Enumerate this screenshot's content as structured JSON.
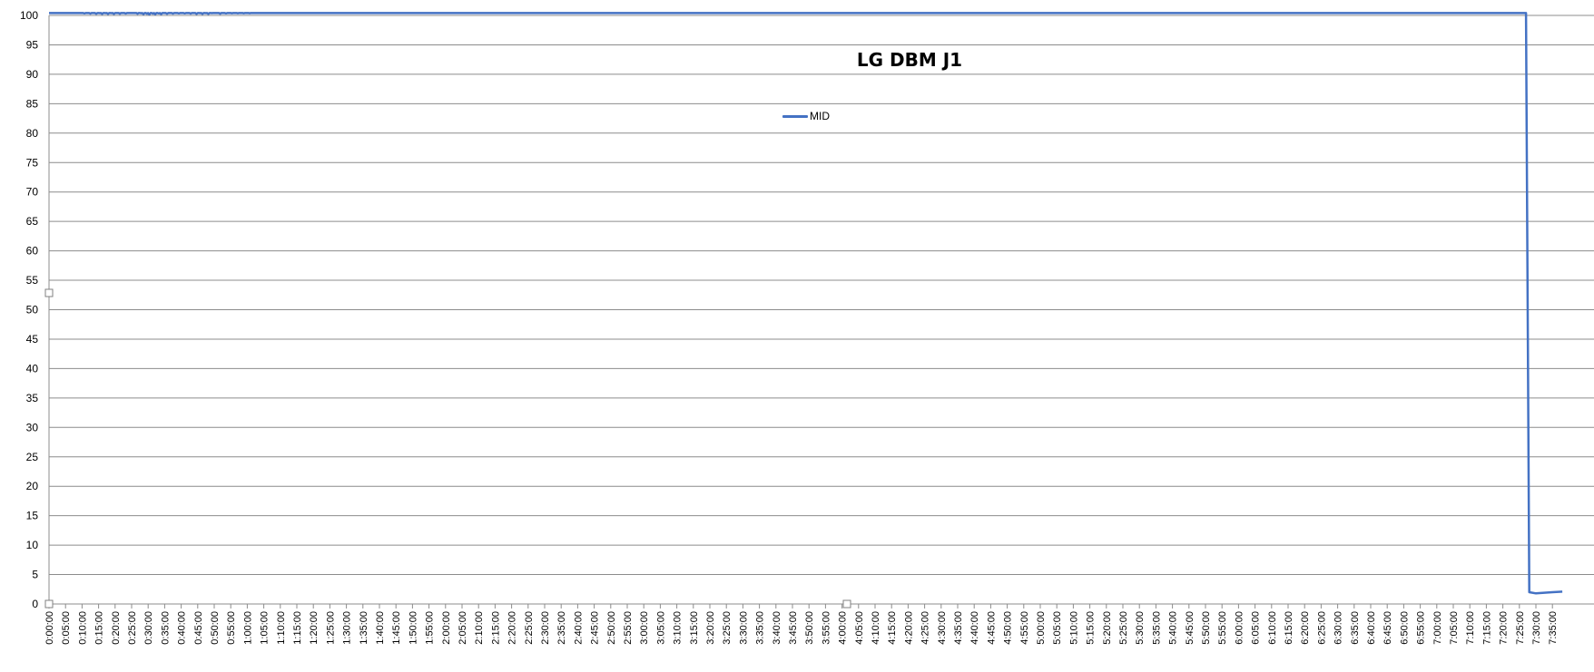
{
  "chart_data": {
    "type": "line",
    "title": "LG DBM J1",
    "xlabel": "",
    "ylabel": "",
    "ylim": [
      0,
      100
    ],
    "yticks": [
      "0",
      "5",
      "10",
      "15",
      "20",
      "25",
      "30",
      "35",
      "40",
      "45",
      "50",
      "55",
      "60",
      "65",
      "70",
      "75",
      "80",
      "85",
      "90",
      "95",
      "100"
    ],
    "xticks": [
      "0:00:00",
      "0:05:00",
      "0:10:00",
      "0:15:00",
      "0:20:00",
      "0:25:00",
      "0:30:00",
      "0:35:00",
      "0:40:00",
      "0:45:00",
      "0:50:00",
      "0:55:00",
      "1:00:00",
      "1:05:00",
      "1:10:00",
      "1:15:00",
      "1:20:00",
      "1:25:00",
      "1:30:00",
      "1:35:00",
      "1:40:00",
      "1:45:00",
      "1:50:00",
      "1:55:00",
      "2:00:00",
      "2:05:00",
      "2:10:00",
      "2:15:00",
      "2:20:00",
      "2:25:00",
      "2:30:00",
      "2:35:00",
      "2:40:00",
      "2:45:00",
      "2:50:00",
      "2:55:00",
      "3:00:00",
      "3:05:00",
      "3:10:00",
      "3:15:00",
      "3:20:00",
      "3:25:00",
      "3:30:00",
      "3:35:00",
      "3:40:00",
      "3:45:00",
      "3:50:00",
      "3:55:00",
      "4:00:00",
      "4:05:00",
      "4:10:00",
      "4:15:00",
      "4:20:00",
      "4:25:00",
      "4:30:00",
      "4:35:00",
      "4:40:00",
      "4:45:00",
      "4:50:00",
      "4:55:00",
      "5:00:00",
      "5:05:00",
      "5:10:00",
      "5:15:00",
      "5:20:00",
      "5:25:00",
      "5:30:00",
      "5:35:00",
      "5:40:00",
      "5:45:00",
      "5:50:00",
      "5:55:00",
      "6:00:00",
      "6:05:00",
      "6:10:00",
      "6:15:00",
      "6:20:00",
      "6:25:00",
      "6:30:00",
      "6:35:00",
      "6:40:00",
      "6:45:00",
      "6:50:00",
      "6:55:00",
      "7:00:00",
      "7:05:00",
      "7:10:00",
      "7:15:00",
      "7:20:00",
      "7:25:00",
      "7:30:00",
      "7:35:00"
    ],
    "grid": true,
    "legend_position": "top-center",
    "series": [
      {
        "name": "MID",
        "color": "#4472C4",
        "x_minutes": [
          0,
          5,
          10,
          15,
          20,
          25,
          30,
          35,
          40,
          45,
          50,
          55,
          60,
          65,
          70,
          75,
          80,
          85,
          90,
          95,
          100,
          105,
          110,
          115,
          120,
          125,
          130,
          135,
          140,
          145,
          150,
          155,
          160,
          165,
          170,
          175,
          180,
          185,
          190,
          195,
          200,
          205,
          210,
          215,
          220,
          225,
          230,
          235,
          240,
          245,
          250,
          255,
          260,
          265,
          270,
          275,
          280,
          285,
          290,
          295,
          300,
          305,
          310,
          315,
          320,
          325,
          330,
          335,
          340,
          345,
          350,
          355,
          360,
          365,
          370,
          375,
          380,
          385,
          390,
          395,
          400,
          405,
          410,
          415,
          420,
          425,
          430,
          435,
          440,
          445,
          446,
          447,
          448,
          450,
          452,
          455,
          458
        ],
        "values": [
          101.0,
          100.8,
          100.6,
          100.5,
          100.5,
          100.6,
          100.4,
          100.5,
          100.6,
          100.5,
          100.5,
          100.6,
          100.6,
          100.7,
          100.7,
          100.8,
          100.9,
          100.9,
          101.0,
          101.0,
          100.9,
          101.0,
          100.9,
          101.0,
          101.0,
          101.1,
          101.1,
          101.2,
          101.2,
          101.2,
          101.1,
          101.0,
          101.0,
          101.1,
          101.1,
          101.1,
          101.2,
          101.2,
          101.2,
          101.3,
          101.2,
          101.2,
          101.3,
          101.4,
          101.4,
          101.4,
          101.3,
          101.4,
          101.4,
          101.5,
          101.5,
          101.5,
          101.5,
          101.6,
          101.6,
          101.6,
          101.6,
          101.7,
          101.6,
          101.6,
          101.7,
          101.7,
          101.8,
          101.8,
          101.8,
          101.8,
          101.8,
          101.8,
          101.9,
          101.9,
          101.9,
          101.9,
          101.9,
          101.9,
          101.9,
          101.9,
          101.9,
          101.8,
          101.8,
          101.8,
          101.8,
          101.9,
          102.0,
          102.1,
          102.1,
          102.1,
          102.0,
          102.0,
          102.0,
          102.3,
          102.2,
          101.5,
          2.0,
          1.8,
          1.9,
          2.0,
          2.1
        ]
      }
    ]
  }
}
